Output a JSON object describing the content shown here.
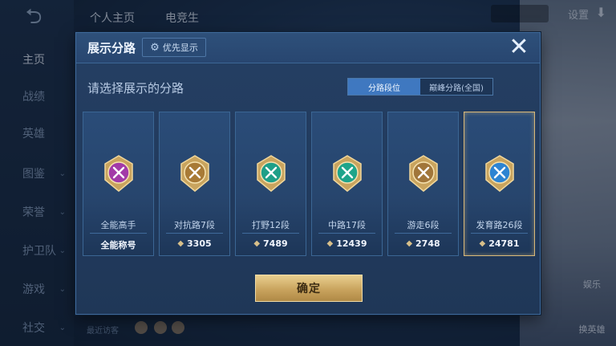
{
  "background": {
    "sidebar": [
      {
        "label": "主页",
        "chevron": false,
        "active": true
      },
      {
        "label": "战绩",
        "chevron": false,
        "active": false
      },
      {
        "label": "英雄",
        "chevron": false,
        "active": false
      },
      {
        "label": "图鉴",
        "chevron": true,
        "active": false
      },
      {
        "label": "荣誉",
        "chevron": true,
        "active": false
      },
      {
        "label": "护卫队",
        "chevron": true,
        "active": false
      },
      {
        "label": "游戏",
        "chevron": true,
        "active": false
      },
      {
        "label": "社交",
        "chevron": true,
        "active": false
      }
    ],
    "tabs": [
      "个人主页",
      "电竞生"
    ],
    "settings_label": "设置",
    "right_buttons": [
      "娱乐",
      "换英雄"
    ],
    "recent_visitors_label": "最近访客"
  },
  "modal": {
    "title": "展示分路",
    "priority_button_label": "优先显示",
    "close_icon": "close-icon",
    "subtitle": "请选择展示的分路",
    "toggle": {
      "options": [
        "分路段位",
        "巅峰分路(全国)"
      ],
      "selected_index": 0
    },
    "cards": [
      {
        "rank": "全能高手",
        "score": "全能称号",
        "has_diamond": false,
        "emblem_color": "#a23aa8",
        "emblem": "all-round-emblem-icon"
      },
      {
        "rank": "对抗路7段",
        "score": "3305",
        "has_diamond": true,
        "emblem_color": "#a87a36",
        "emblem": "clash-lane-emblem-icon"
      },
      {
        "rank": "打野12段",
        "score": "7489",
        "has_diamond": true,
        "emblem_color": "#1e9f88",
        "emblem": "jungle-emblem-icon"
      },
      {
        "rank": "中路17段",
        "score": "12439",
        "has_diamond": true,
        "emblem_color": "#1fa48a",
        "emblem": "mid-lane-emblem-icon"
      },
      {
        "rank": "游走6段",
        "score": "2748",
        "has_diamond": true,
        "emblem_color": "#a1763a",
        "emblem": "roam-emblem-icon"
      },
      {
        "rank": "发育路26段",
        "score": "24781",
        "has_diamond": true,
        "emblem_color": "#2d84d2",
        "emblem": "farm-lane-emblem-icon"
      }
    ],
    "selected_card_index": 5,
    "confirm_label": "确定"
  }
}
